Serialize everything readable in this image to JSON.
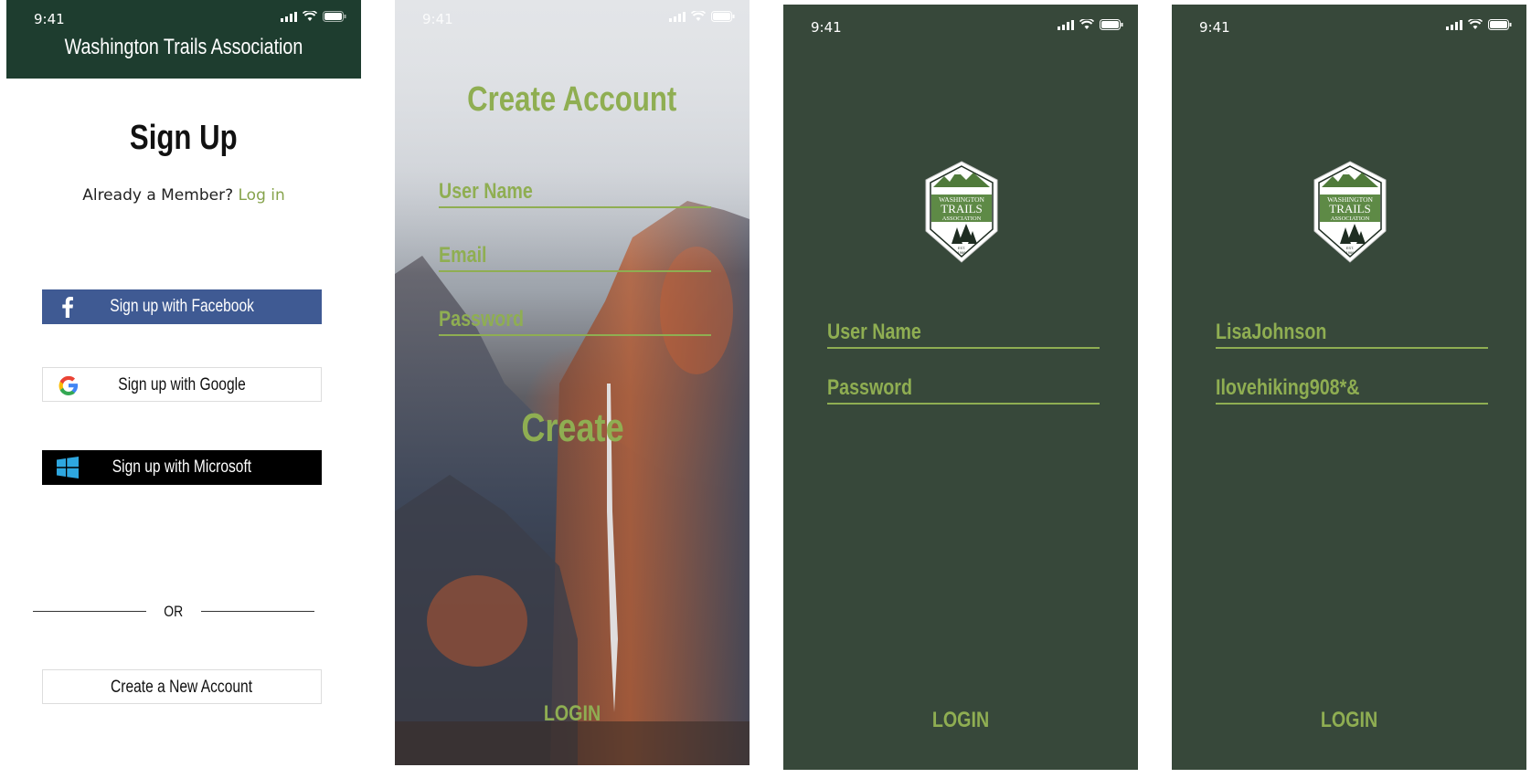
{
  "status": {
    "time": "9:41"
  },
  "signup_screen": {
    "app_title": "Washington Trails Association",
    "title": "Sign Up",
    "already_member": "Already a Member?",
    "login_link": "Log in",
    "facebook_button": "Sign up with Facebook",
    "google_button": "Sign up with Google",
    "microsoft_button": "Sign up with Microsoft",
    "divider_text": "OR",
    "create_account_button": "Create a New Account",
    "colors": {
      "header": "#1e3d2f",
      "facebook": "#3f5a93",
      "link": "#86a34c"
    }
  },
  "create_account_screen": {
    "title": "Create Account",
    "fields": {
      "username_label": "User Name",
      "email_label": "Email",
      "password_label": "Password"
    },
    "create_button": "Create",
    "login_link": "LOGIN",
    "accent_color": "#8fae52"
  },
  "login_screen": {
    "logo": {
      "line1": "WASHINGTON",
      "line2": "TRAILS",
      "line3": "ASSOCIATION",
      "est": "EST.",
      "year": "1966"
    },
    "fields": {
      "username_label": "User Name",
      "password_label": "Password"
    },
    "login_link": "LOGIN",
    "background_color": "#37483a"
  },
  "login_filled_screen": {
    "fields": {
      "username_value": "LisaJohnson",
      "password_value": "Ilovehiking908*&"
    },
    "login_link": "LOGIN"
  }
}
